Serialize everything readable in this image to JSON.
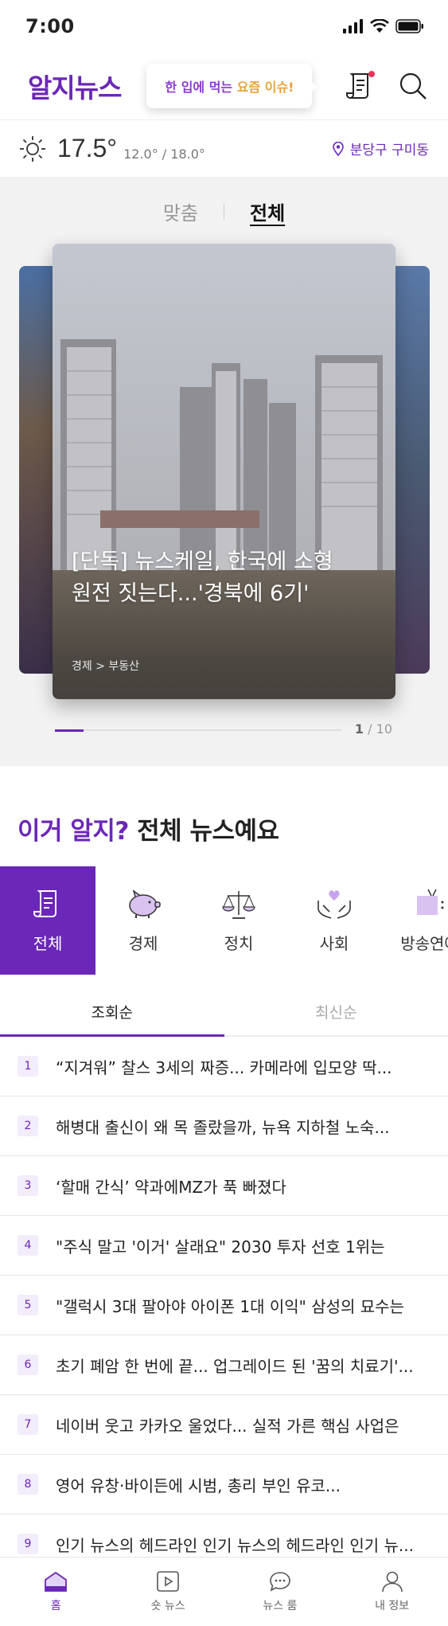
{
  "status_bar": {
    "time": "7:00"
  },
  "header": {
    "logo": "알지뉴스",
    "promo_part1": "한 입에 먹는",
    "promo_part2": "요즘 이슈!"
  },
  "weather": {
    "temperature": "17.5°",
    "range": "12.0° / 18.0°",
    "location": "분당구 구미동"
  },
  "feed_toggle": {
    "options": [
      "맞춤",
      "전체"
    ],
    "selected": "전체"
  },
  "featured": {
    "title_line1": "[단독]      뉴스케일, 한국에 소형",
    "title_line2": "원전 짓는다...'경북에 6기'",
    "category": "경제 > 부동산",
    "current_page": "1",
    "total_pages": "/ 10",
    "progress": 0.1
  },
  "section": {
    "heading_accent": "이거 알지?",
    "heading_rest": " 전체 뉴스예요"
  },
  "categories": [
    {
      "label": "전체",
      "icon": "document-icon"
    },
    {
      "label": "경제",
      "icon": "piggy-bank-icon"
    },
    {
      "label": "정치",
      "icon": "scale-icon"
    },
    {
      "label": "사회",
      "icon": "heart-hands-icon"
    },
    {
      "label": "방송연예",
      "icon": "tv-icon"
    }
  ],
  "sort_tabs": [
    "조회순",
    "최신순"
  ],
  "news_list": [
    {
      "rank": "1",
      "headline": "“지겨워”    찰스 3세의 짜증... 카메라에 입모양 딱..."
    },
    {
      "rank": "2",
      "headline": "    해병대 출신이 왜 목 졸랐을까, 뉴욕 지하철 노숙..."
    },
    {
      "rank": "3",
      "headline": "‘할매 간식’ 약과에MZ가 푹 빠졌다"
    },
    {
      "rank": "4",
      "headline": "\"주식 말고 '이거' 살래요\" 2030 투자 선호 1위는"
    },
    {
      "rank": "5",
      "headline": "\"갤럭시 3대 팔아야 아이폰 1대 이익\" 삼성의 묘수는"
    },
    {
      "rank": "6",
      "headline": "초기 폐암 한 번에 끝... 업그레이드 된 '꿈의 치료기'..."
    },
    {
      "rank": "7",
      "headline": "네이버 웃고 카카오 울었다... 실적 가른 핵심 사업은"
    },
    {
      "rank": "8",
      "headline": "영어 유창·바이든에          시범,     총리 부인 유코..."
    },
    {
      "rank": "9",
      "headline": "인기 뉴스의 헤드라인 인기 뉴스의 헤드라인 인기 뉴..."
    }
  ],
  "bottom_nav": [
    {
      "label": "홈",
      "icon": "home-icon"
    },
    {
      "label": "숏 뉴스",
      "icon": "play-icon"
    },
    {
      "label": "뉴스 룸",
      "icon": "chat-icon"
    },
    {
      "label": "내 정보",
      "icon": "user-icon"
    }
  ],
  "colors": {
    "accent": "#6b27b8",
    "promo_highlight": "#e8a23d",
    "notification": "#e8335a"
  }
}
